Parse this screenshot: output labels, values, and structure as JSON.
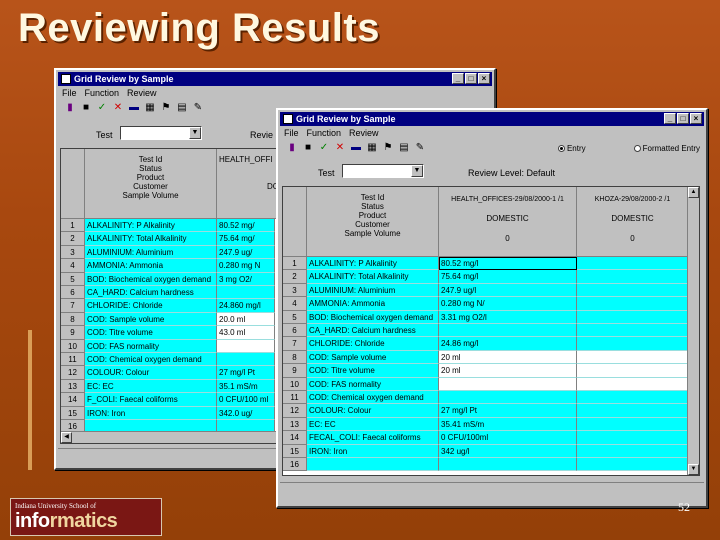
{
  "slide": {
    "title": "Reviewing Results",
    "page_number": "52"
  },
  "logo": {
    "line1": "Indiana University School of",
    "brand_a": "info",
    "brand_b": "rmatics"
  },
  "back_window": {
    "title": "Grid Review by Sample",
    "menu": [
      "File",
      "Function",
      "Review"
    ],
    "test_label": "Test",
    "review_label": "Revie",
    "header_labels": "Test Id\nStatus\nProduct\nCustomer\nSample Volume",
    "col1_header": "HEALTH_OFFI",
    "col1_sub": "DO",
    "rows": [
      {
        "n": "1",
        "test": "ALKALINITY: P Alkalinity",
        "val": "80.52 mg/"
      },
      {
        "n": "2",
        "test": "ALKALINITY: Total Alkalinity",
        "val": "75.64 mg/"
      },
      {
        "n": "3",
        "test": "ALUMINIUM: Aluminium",
        "val": "247.9 ug/"
      },
      {
        "n": "4",
        "test": "AMMONIA: Ammonia",
        "val": "0.280 mg N"
      },
      {
        "n": "5",
        "test": "BOD: Biochemical oxygen demand",
        "val": "3 mg O2/"
      },
      {
        "n": "6",
        "test": "CA_HARD: Calcium hardness",
        "val": ""
      },
      {
        "n": "7",
        "test": "CHLORIDE: Chloride",
        "val": "24.860 mg/l"
      },
      {
        "n": "8",
        "test": "COD: Sample volume",
        "val": "20.0 ml"
      },
      {
        "n": "9",
        "test": "COD: Titre volume",
        "val": "43.0 ml"
      },
      {
        "n": "10",
        "test": "COD: FAS normality",
        "val": ""
      },
      {
        "n": "11",
        "test": "COD: Chemical oxygen demand",
        "val": ""
      },
      {
        "n": "12",
        "test": "COLOUR: Colour",
        "val": "27 mg/l Pt"
      },
      {
        "n": "13",
        "test": "EC: EC",
        "val": "35.1 mS/m"
      },
      {
        "n": "14",
        "test": "F_COLI: Faecal coliforms",
        "val": "0 CFU/100 ml"
      },
      {
        "n": "15",
        "test": "IRON: Iron",
        "val": "342.0 ug/"
      },
      {
        "n": "16",
        "test": "",
        "val": ""
      }
    ]
  },
  "front_window": {
    "title": "Grid Review by Sample",
    "menu": [
      "File",
      "Function",
      "Review"
    ],
    "test_label": "Test",
    "review_level_label": "Review Level: Default",
    "radio_entry": "Entry",
    "radio_formatted": "Formatted Entry",
    "header_labels": "Test Id\nStatus\nProduct\nCustomer\nSample Volume",
    "col1_header": "HEALTH_OFFICES-29/08/2000-1 /1",
    "col1_product": "DOMESTIC",
    "col1_vol": "0",
    "col2_header": "KHOZA-29/08/2000-2 /1",
    "col2_product": "DOMESTIC",
    "col2_vol": "0",
    "rows": [
      {
        "n": "1",
        "test": "ALKALINITY: P Alkalinity",
        "val": "80.52 mg/l",
        "bg": "cyan"
      },
      {
        "n": "2",
        "test": "ALKALINITY: Total Alkalinity",
        "val": "75.64 mg/l",
        "bg": "cyan"
      },
      {
        "n": "3",
        "test": "ALUMINIUM: Aluminium",
        "val": "247.9 ug/l",
        "bg": "cyan"
      },
      {
        "n": "4",
        "test": "AMMONIA: Ammonia",
        "val": "0.280 mg N/",
        "bg": "cyan"
      },
      {
        "n": "5",
        "test": "BOD: Biochemical oxygen demand",
        "val": "3.31 mg O2/l",
        "bg": "cyan"
      },
      {
        "n": "6",
        "test": "CA_HARD: Calcium hardness",
        "val": "",
        "bg": "cyan"
      },
      {
        "n": "7",
        "test": "CHLORIDE: Chloride",
        "val": "24.86 mg/l",
        "bg": "cyan"
      },
      {
        "n": "8",
        "test": "COD: Sample volume",
        "val": "20 ml",
        "bg": "white"
      },
      {
        "n": "9",
        "test": "COD: Titre volume",
        "val": "20 ml",
        "bg": "white"
      },
      {
        "n": "10",
        "test": "COD: FAS normality",
        "val": "",
        "bg": "white"
      },
      {
        "n": "11",
        "test": "COD: Chemical oxygen demand",
        "val": "",
        "bg": "cyan"
      },
      {
        "n": "12",
        "test": "COLOUR: Colour",
        "val": "27 mg/l Pt",
        "bg": "cyan"
      },
      {
        "n": "13",
        "test": "EC: EC",
        "val": "35.41 mS/m",
        "bg": "cyan"
      },
      {
        "n": "14",
        "test": "FECAL_COLI: Faecal coliforms",
        "val": "0 CFU/100ml",
        "bg": "cyan"
      },
      {
        "n": "15",
        "test": "IRON: Iron",
        "val": "342 ug/l",
        "bg": "cyan"
      },
      {
        "n": "16",
        "test": "",
        "val": "",
        "bg": "cyan"
      }
    ]
  },
  "colors": {
    "cyan": "#00ffff",
    "titlebar": "#000080",
    "background": "#a84a12"
  }
}
